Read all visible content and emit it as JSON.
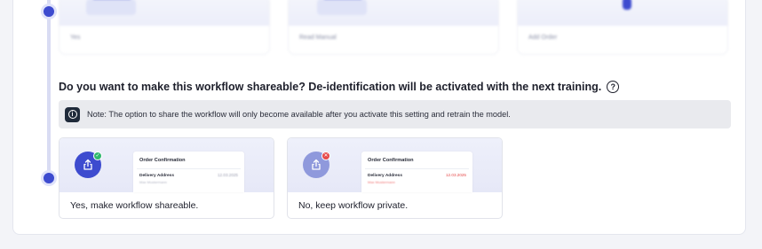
{
  "top_cards": [
    {
      "label": "Yes"
    },
    {
      "label": "Read Manual"
    },
    {
      "label": "Add Order"
    }
  ],
  "question": {
    "text": "Do you want to make this workflow shareable? De-identification will be activated with the next training.",
    "help_icon": "?"
  },
  "note": {
    "icon": "i",
    "text": "Note: The option to share the workflow will only become available after you activate this setting and retrain the model."
  },
  "options": [
    {
      "preview_title": "Order Confirmation",
      "preview_field": "Delivery Address",
      "preview_sub": "Max Mustermann",
      "preview_date": "12.03.2025",
      "status_icon": "check-badge-icon",
      "caption": "Yes, make workflow shareable."
    },
    {
      "preview_title": "Order Confirmation",
      "preview_field": "Delivery Address",
      "preview_sub": "Max Mustermann",
      "preview_date": "12.03.2025",
      "status_icon": "cross-badge-icon",
      "caption": "No, keep workflow private."
    }
  ],
  "colors": {
    "accent": "#3d4bcf",
    "accent_muted": "#8f99dc",
    "success": "#2fb86c",
    "danger": "#e64a4a",
    "note_bg": "#e9eaee"
  }
}
